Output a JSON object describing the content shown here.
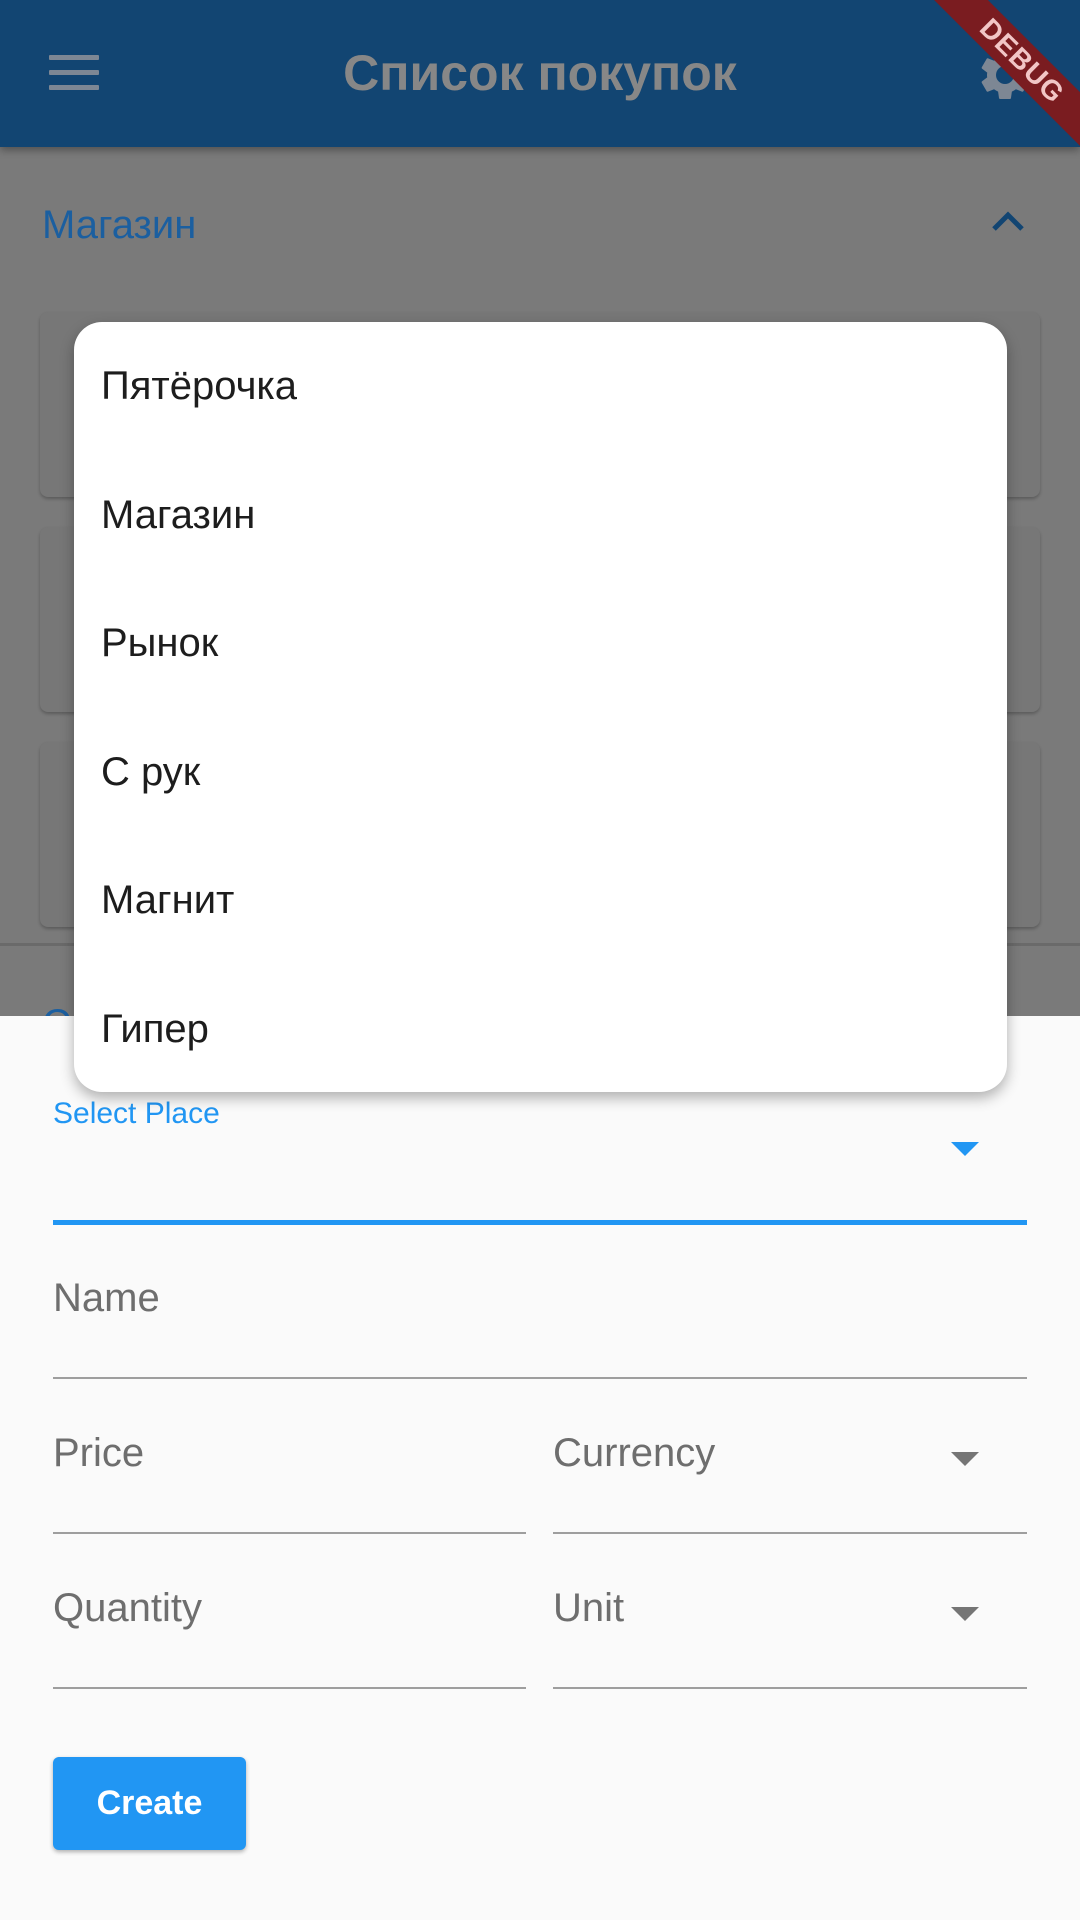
{
  "app_bar": {
    "title": "Список покупок",
    "menu_icon": "menu-icon",
    "settings_icon": "settings-icon",
    "debug_banner": "DEBUG"
  },
  "background": {
    "section_title": "Магазин",
    "partial_text": "С"
  },
  "dropdown": {
    "items": [
      "Пятёрочка",
      "Магазин",
      "Рынок",
      "С рук",
      "Магнит",
      "Гипер"
    ]
  },
  "form": {
    "place_label": "Select Place",
    "name_hint": "Name",
    "price_hint": "Price",
    "currency_hint": "Currency",
    "quantity_hint": "Quantity",
    "unit_hint": "Unit",
    "create_label": "Create"
  },
  "colors": {
    "app_bar": "#124572",
    "accent": "#2196f3",
    "scrim": "#7a7a7a"
  }
}
